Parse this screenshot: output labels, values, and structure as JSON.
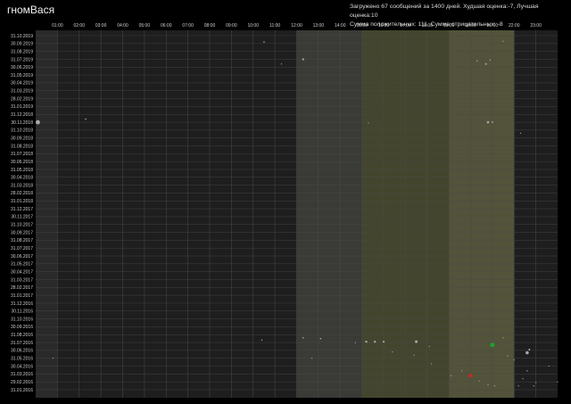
{
  "header": {
    "user_title": "гномВася",
    "stats_line1": "Загружено 67 сообщений за 1400 дней. Худшая оценка:-7, Лучшая оценка:10",
    "stats_line2": "Сумма положительных: 111, Сумма отрицательных: -8"
  },
  "colors": {
    "background": "#000000",
    "plot": "#1e1e1e",
    "band_dark": "#2a2a2a",
    "band_grey": "#3a3b37",
    "band_olive": "#44452e",
    "band_olive_light": "#52533a",
    "grid": "#4a4a4a",
    "dot": "#aaaaaa",
    "positive": "#1f9e2e",
    "negative": "#d9241c"
  },
  "chart_data": {
    "type": "scatter",
    "x_axis": {
      "unit": "hour",
      "range": [
        0,
        24
      ],
      "ticks": [
        "01:00",
        "02:00",
        "03:00",
        "04:00",
        "05:00",
        "06:00",
        "07:00",
        "08:00",
        "09:00",
        "10:00",
        "11:00",
        "12:00",
        "13:00",
        "14:00",
        "15:00",
        "16:00",
        "17:00",
        "18:00",
        "19:00",
        "20:00",
        "21:00",
        "22:00",
        "23:00"
      ]
    },
    "y_axis": {
      "unit": "month",
      "range": [
        "01.2016",
        "10.2019"
      ],
      "direction": "top-to-bottom descending",
      "ticks": [
        "31.10.2019",
        "30.09.2019",
        "31.08.2019",
        "31.07.2019",
        "30.06.2019",
        "31.05.2019",
        "30.04.2019",
        "31.03.2019",
        "28.02.2019",
        "31.01.2019",
        "31.12.2018",
        "30.11.2018",
        "31.10.2018",
        "30.09.2018",
        "31.08.2018",
        "31.07.2018",
        "30.06.2018",
        "31.05.2018",
        "30.04.2018",
        "31.03.2018",
        "28.02.2018",
        "31.01.2018",
        "31.12.2017",
        "30.11.2017",
        "31.10.2017",
        "30.09.2017",
        "31.08.2017",
        "31.07.2017",
        "30.06.2017",
        "31.05.2017",
        "30.04.2017",
        "31.03.2017",
        "28.02.2017",
        "31.01.2017",
        "31.12.2016",
        "30.11.2016",
        "31.10.2016",
        "30.09.2016",
        "31.08.2016",
        "31.07.2016",
        "30.06.2016",
        "31.05.2016",
        "30.04.2016",
        "31.03.2016",
        "29.02.2016",
        "31.01.2016"
      ]
    },
    "time_bands": [
      {
        "from": 0,
        "to": 1,
        "tone": "band_dark"
      },
      {
        "from": 12,
        "to": 15,
        "tone": "band_grey"
      },
      {
        "from": 15,
        "to": 19,
        "tone": "band_olive"
      },
      {
        "from": 19,
        "to": 22,
        "tone": "band_olive_light"
      }
    ],
    "grid": true,
    "points": [
      {
        "hour": 0.1,
        "month": 34.0,
        "size": 2.4,
        "kind": "neutral"
      },
      {
        "hour": 2.3,
        "month": 34.4,
        "size": 0.8,
        "kind": "neutral"
      },
      {
        "hour": 10.5,
        "month": 44.2,
        "size": 0.8,
        "kind": "neutral"
      },
      {
        "hour": 11.3,
        "month": 41.4,
        "size": 0.6,
        "kind": "neutral"
      },
      {
        "hour": 12.3,
        "month": 42.0,
        "size": 1.1,
        "kind": "neutral"
      },
      {
        "hour": 15.3,
        "month": 33.9,
        "size": 0.6,
        "kind": "neutral"
      },
      {
        "hour": 20.3,
        "month": 41.8,
        "size": 0.7,
        "kind": "neutral"
      },
      {
        "hour": 20.7,
        "month": 41.4,
        "size": 1.0,
        "kind": "neutral"
      },
      {
        "hour": 20.9,
        "month": 41.9,
        "size": 0.7,
        "kind": "neutral"
      },
      {
        "hour": 21.5,
        "month": 44.3,
        "size": 0.6,
        "kind": "neutral"
      },
      {
        "hour": 20.8,
        "month": 34.0,
        "size": 1.3,
        "kind": "neutral"
      },
      {
        "hour": 21.0,
        "month": 34.0,
        "size": 0.9,
        "kind": "neutral"
      },
      {
        "hour": 22.3,
        "month": 32.6,
        "size": 0.6,
        "kind": "neutral"
      },
      {
        "hour": 0.8,
        "month": 4.0,
        "size": 0.6,
        "kind": "neutral"
      },
      {
        "hour": 10.4,
        "month": 6.3,
        "size": 0.7,
        "kind": "neutral"
      },
      {
        "hour": 12.3,
        "month": 6.6,
        "size": 0.8,
        "kind": "neutral"
      },
      {
        "hour": 12.7,
        "month": 4.0,
        "size": 0.6,
        "kind": "neutral"
      },
      {
        "hour": 13.1,
        "month": 6.5,
        "size": 0.8,
        "kind": "neutral"
      },
      {
        "hour": 14.7,
        "month": 6.0,
        "size": 0.6,
        "kind": "neutral"
      },
      {
        "hour": 15.2,
        "month": 6.1,
        "size": 1.2,
        "kind": "neutral"
      },
      {
        "hour": 15.6,
        "month": 6.1,
        "size": 1.2,
        "kind": "neutral"
      },
      {
        "hour": 16.0,
        "month": 6.1,
        "size": 1.1,
        "kind": "neutral"
      },
      {
        "hour": 16.4,
        "month": 4.8,
        "size": 0.6,
        "kind": "neutral"
      },
      {
        "hour": 17.5,
        "month": 6.1,
        "size": 1.5,
        "kind": "neutral"
      },
      {
        "hour": 18.1,
        "month": 5.5,
        "size": 0.6,
        "kind": "neutral"
      },
      {
        "hour": 17.4,
        "month": 4.4,
        "size": 0.6,
        "kind": "neutral"
      },
      {
        "hour": 18.2,
        "month": 3.3,
        "size": 0.6,
        "kind": "neutral"
      },
      {
        "hour": 19.1,
        "month": 1.8,
        "size": 0.6,
        "kind": "neutral"
      },
      {
        "hour": 19.6,
        "month": 2.4,
        "size": 0.6,
        "kind": "neutral"
      },
      {
        "hour": 20.0,
        "month": 1.8,
        "size": 2.0,
        "kind": "negative"
      },
      {
        "hour": 20.4,
        "month": 1.1,
        "size": 0.6,
        "kind": "neutral"
      },
      {
        "hour": 21.0,
        "month": 5.7,
        "size": 2.6,
        "kind": "positive"
      },
      {
        "hour": 21.1,
        "month": 0.5,
        "size": 0.6,
        "kind": "neutral"
      },
      {
        "hour": 21.5,
        "month": 6.6,
        "size": 0.6,
        "kind": "neutral"
      },
      {
        "hour": 21.7,
        "month": 4.3,
        "size": 0.6,
        "kind": "neutral"
      },
      {
        "hour": 22.0,
        "month": 3.8,
        "size": 0.6,
        "kind": "neutral"
      },
      {
        "hour": 22.4,
        "month": 1.4,
        "size": 0.6,
        "kind": "neutral"
      },
      {
        "hour": 22.6,
        "month": 4.7,
        "size": 1.8,
        "kind": "neutral"
      },
      {
        "hour": 22.7,
        "month": 5.1,
        "size": 1.0,
        "kind": "neutral"
      },
      {
        "hour": 22.6,
        "month": 2.4,
        "size": 0.7,
        "kind": "neutral"
      },
      {
        "hour": 22.2,
        "month": 0.5,
        "size": 0.6,
        "kind": "neutral"
      },
      {
        "hour": 22.9,
        "month": 0.5,
        "size": 0.6,
        "kind": "neutral"
      },
      {
        "hour": 23.6,
        "month": 3.0,
        "size": 0.6,
        "kind": "neutral"
      },
      {
        "hour": 24.0,
        "month": 1.0,
        "size": 0.6,
        "kind": "neutral"
      },
      {
        "hour": 23.0,
        "month": 0.9,
        "size": 0.6,
        "kind": "neutral"
      },
      {
        "hour": 20.8,
        "month": 0.6,
        "size": 0.6,
        "kind": "neutral"
      }
    ]
  }
}
